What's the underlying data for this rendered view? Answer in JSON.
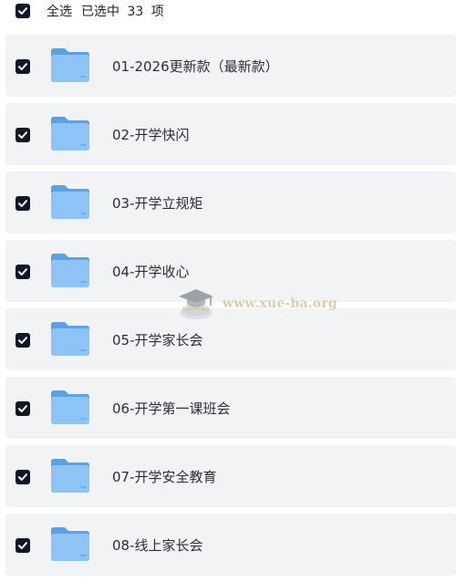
{
  "toolbar": {
    "select_all_label": "全选",
    "selected_count": "已选中 33 项",
    "select_all_checked": true
  },
  "folders": [
    {
      "label": "01-2026更新款（最新款）",
      "checked": true,
      "icon": "folder-icon"
    },
    {
      "label": "02-开学快闪",
      "checked": true,
      "icon": "folder-icon"
    },
    {
      "label": "03-开学立规矩",
      "checked": true,
      "icon": "folder-icon"
    },
    {
      "label": "04-开学收心",
      "checked": true,
      "icon": "folder-icon"
    },
    {
      "label": "05-开学家长会",
      "checked": true,
      "icon": "folder-icon"
    },
    {
      "label": "06-开学第一课班会",
      "checked": true,
      "icon": "folder-icon"
    },
    {
      "label": "07-开学安全教育",
      "checked": true,
      "icon": "folder-icon"
    },
    {
      "label": "08-线上家长会",
      "checked": true,
      "icon": "folder-icon"
    }
  ],
  "watermark": {
    "text": "www.xue-ba.org",
    "icon": "graduation-cap-logo"
  },
  "colors": {
    "checkbox_fill": "#101828",
    "row_background": "#f2f3f5",
    "folder_blue": "#7bb8f0"
  }
}
